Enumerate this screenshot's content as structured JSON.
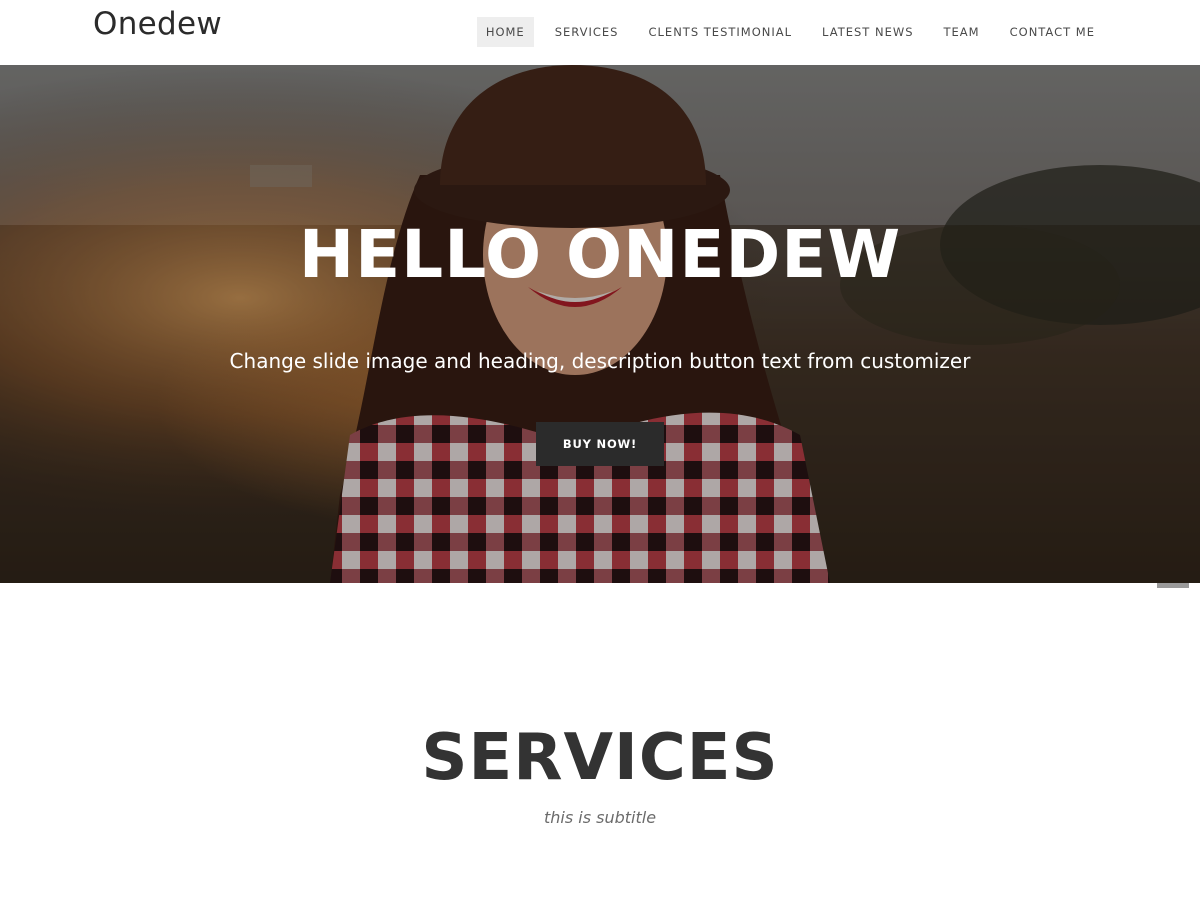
{
  "header": {
    "brand": "Onedew",
    "nav": [
      {
        "label": "HOME",
        "active": true
      },
      {
        "label": "SERVICES",
        "active": false
      },
      {
        "label": "CLENTS TESTIMONIAL",
        "active": false
      },
      {
        "label": "LATEST NEWS",
        "active": false
      },
      {
        "label": "TEAM",
        "active": false
      },
      {
        "label": "CONTACT ME",
        "active": false
      }
    ]
  },
  "hero": {
    "heading": "HELLO ONEDEW",
    "description": "Change slide image and heading, description button text from customizer",
    "button_label": "BUY NOW!",
    "image": "woman-in-hat-photo"
  },
  "services": {
    "title": "SERVICES",
    "subtitle": "this is subtitle"
  },
  "colors": {
    "dark_button": "#2b2b2b",
    "active_nav_bg": "#eeeeee",
    "heading_text": "#333333"
  }
}
